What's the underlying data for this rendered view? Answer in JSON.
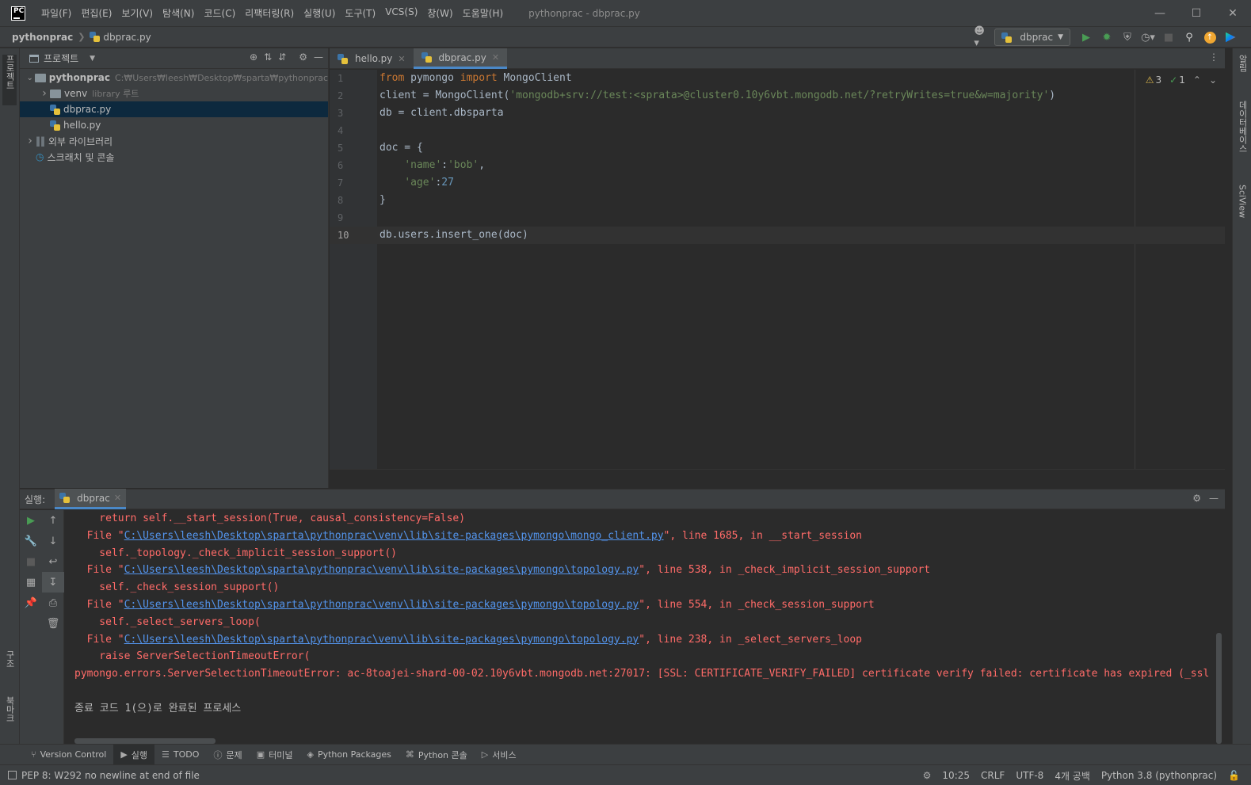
{
  "window": {
    "title": "pythonprac - dbprac.py",
    "logo_text": "PC"
  },
  "menu": [
    "파일(F)",
    "편집(E)",
    "보기(V)",
    "탐색(N)",
    "코드(C)",
    "리팩터링(R)",
    "실행(U)",
    "도구(T)",
    "VCS(S)",
    "창(W)",
    "도움말(H)"
  ],
  "breadcrumb": {
    "project": "pythonprac",
    "file": "dbprac.py"
  },
  "run_config": {
    "name": "dbprac"
  },
  "left_strip": {
    "project_tab": "프로젝트",
    "structure_tab": "구조",
    "bookmarks_tab": "북마크"
  },
  "right_strip": {
    "notifications_tab": "알림",
    "database_tab": "데이터베이스",
    "sciview_tab": "SciView"
  },
  "project_panel": {
    "title": "프로젝트",
    "tree": [
      {
        "label": "pythonprac",
        "hint": "C:₩Users₩leesh₩Desktop₩sparta₩pythonprac",
        "level": 0,
        "type": "folder",
        "expanded": true
      },
      {
        "label": "venv",
        "hint": "library 루트",
        "level": 1,
        "type": "folder",
        "expanded": false
      },
      {
        "label": "dbprac.py",
        "hint": "",
        "level": 1,
        "type": "py",
        "selected": true
      },
      {
        "label": "hello.py",
        "hint": "",
        "level": 1,
        "type": "py"
      },
      {
        "label": "외부 라이브러리",
        "hint": "",
        "level": 0,
        "type": "lib",
        "expanded": false
      },
      {
        "label": "스크래치 및 콘솔",
        "hint": "",
        "level": 0,
        "type": "scratch"
      }
    ]
  },
  "editor": {
    "tabs": [
      {
        "label": "hello.py",
        "active": false
      },
      {
        "label": "dbprac.py",
        "active": true
      }
    ],
    "inspections": {
      "warnings": "3",
      "typos": "1"
    },
    "caret_line": 10,
    "lines": [
      {
        "n": "1",
        "html": "<span class=\"kw\">from</span> pymongo <span class=\"kw\">import</span> MongoClient"
      },
      {
        "n": "2",
        "html": "client = MongoClient(<span class=\"str\">'mongodb+srv://test:&lt;sprata&gt;@cluster0.10y6vbt.mongodb.net/?retryWrites=true&amp;w=majority'</span>)"
      },
      {
        "n": "3",
        "html": "db = client.dbsparta"
      },
      {
        "n": "4",
        "html": ""
      },
      {
        "n": "5",
        "html": "doc = {"
      },
      {
        "n": "6",
        "html": "    <span class=\"str\">'name'</span>:<span class=\"str\">'bob'</span>,"
      },
      {
        "n": "7",
        "html": "    <span class=\"str\">'age'</span>:<span class=\"num\">27</span>"
      },
      {
        "n": "8",
        "html": "}"
      },
      {
        "n": "9",
        "html": ""
      },
      {
        "n": "10",
        "html": "db.users.insert_one(doc)"
      }
    ]
  },
  "run_panel": {
    "label": "실행:",
    "tab": "dbprac",
    "console": [
      {
        "kind": "err",
        "pre": "    return self.__start_session(True, causal_consistency=False)",
        "link": "",
        "post": ""
      },
      {
        "kind": "err",
        "pre": "  File \"",
        "link": "C:\\Users\\leesh\\Desktop\\sparta\\pythonprac\\venv\\lib\\site-packages\\pymongo\\mongo_client.py",
        "post": "\", line 1685, in __start_session"
      },
      {
        "kind": "err",
        "pre": "    self._topology._check_implicit_session_support()",
        "link": "",
        "post": ""
      },
      {
        "kind": "err",
        "pre": "  File \"",
        "link": "C:\\Users\\leesh\\Desktop\\sparta\\pythonprac\\venv\\lib\\site-packages\\pymongo\\topology.py",
        "post": "\", line 538, in _check_implicit_session_support"
      },
      {
        "kind": "err",
        "pre": "    self._check_session_support()",
        "link": "",
        "post": ""
      },
      {
        "kind": "err",
        "pre": "  File \"",
        "link": "C:\\Users\\leesh\\Desktop\\sparta\\pythonprac\\venv\\lib\\site-packages\\pymongo\\topology.py",
        "post": "\", line 554, in _check_session_support"
      },
      {
        "kind": "err",
        "pre": "    self._select_servers_loop(",
        "link": "",
        "post": ""
      },
      {
        "kind": "err",
        "pre": "  File \"",
        "link": "C:\\Users\\leesh\\Desktop\\sparta\\pythonprac\\venv\\lib\\site-packages\\pymongo\\topology.py",
        "post": "\", line 238, in _select_servers_loop"
      },
      {
        "kind": "err",
        "pre": "    raise ServerSelectionTimeoutError(",
        "link": "",
        "post": ""
      },
      {
        "kind": "err",
        "pre": "pymongo.errors.ServerSelectionTimeoutError: ac-8toajei-shard-00-02.10y6vbt.mongodb.net:27017: [SSL: CERTIFICATE_VERIFY_FAILED] certificate verify failed: certificate has expired (_ssl",
        "link": "",
        "post": ""
      },
      {
        "kind": "blank",
        "pre": "",
        "link": "",
        "post": ""
      },
      {
        "kind": "plain",
        "pre": "종료 코드 1(으)로 완료된 프로세스",
        "link": "",
        "post": ""
      }
    ]
  },
  "tool_windows": [
    {
      "label": "Version Control",
      "icon": "git-branch-icon",
      "active": false
    },
    {
      "label": "실행",
      "icon": "run-icon",
      "active": true
    },
    {
      "label": "TODO",
      "icon": "list-icon",
      "active": false
    },
    {
      "label": "문제",
      "icon": "problems-icon",
      "active": false
    },
    {
      "label": "터미널",
      "icon": "terminal-icon",
      "active": false
    },
    {
      "label": "Python Packages",
      "icon": "packages-icon",
      "active": false
    },
    {
      "label": "Python 콘솔",
      "icon": "python-console-icon",
      "active": false
    },
    {
      "label": "서비스",
      "icon": "services-icon",
      "active": false
    }
  ],
  "statusbar": {
    "message": "PEP 8: W292 no newline at end of file",
    "position": "10:25",
    "line_sep": "CRLF",
    "encoding": "UTF-8",
    "indent": "4개 공백",
    "interpreter": "Python 3.8 (pythonprac)"
  },
  "colors": {
    "accent": "#4a88c7",
    "error_text": "#ff6b68",
    "link": "#5394ec",
    "run_green": "#499c54"
  }
}
